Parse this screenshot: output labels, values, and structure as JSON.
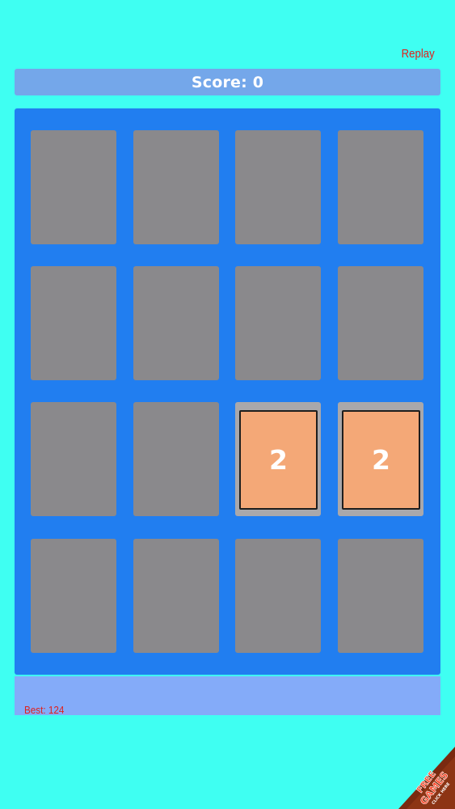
{
  "header": {
    "replay_label": "Replay",
    "score_text": "Score: 0"
  },
  "board": {
    "rows": 4,
    "cols": 4,
    "tiles": [
      [
        "",
        "",
        "",
        ""
      ],
      [
        "",
        "",
        "",
        ""
      ],
      [
        "",
        "",
        "2",
        "2"
      ],
      [
        "",
        "",
        "",
        ""
      ]
    ]
  },
  "footer": {
    "best_text": "Best: 124"
  },
  "promo_badge": {
    "icon": "free-games-badge-icon",
    "line1": "FREE",
    "line2": "GAMES",
    "line3": "CLICK HERE"
  },
  "colors": {
    "background": "#3ffff2",
    "board": "#217ef0",
    "empty_cell": "#8a898c",
    "tile_2": "#f4a877",
    "accent_text": "#e0201c"
  }
}
